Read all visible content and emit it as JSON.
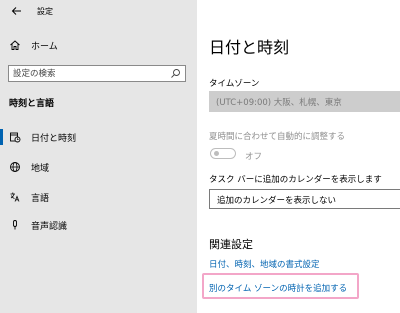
{
  "window": {
    "title": "設定"
  },
  "sidebar": {
    "home_label": "ホーム",
    "search_placeholder": "設定の検索",
    "section_title": "時刻と言語",
    "items": [
      {
        "label": "日付と時刻",
        "icon": "calendar-clock-icon",
        "selected": true
      },
      {
        "label": "地域",
        "icon": "globe-icon",
        "selected": false
      },
      {
        "label": "言語",
        "icon": "language-icon",
        "selected": false
      },
      {
        "label": "音声認識",
        "icon": "microphone-icon",
        "selected": false
      }
    ]
  },
  "main": {
    "title": "日付と時刻",
    "timezone_label": "タイムゾーン",
    "timezone_value": "(UTC+09:00) 大阪、札幌、東京",
    "dst_label": "夏時間に合わせて自動的に調整する",
    "dst_toggle_state": "オフ",
    "calendar_label": "タスク バーに追加のカレンダーを表示します",
    "calendar_value": "追加のカレンダーを表示しない",
    "related_title": "関連設定",
    "related_links": [
      "日付、時刻、地域の書式設定",
      "別のタイム ゾーンの時計を追加する"
    ]
  },
  "colors": {
    "accent": "#0063b1",
    "sidebar_bg": "#e6e6e6",
    "highlight": "#f3a6c8"
  }
}
